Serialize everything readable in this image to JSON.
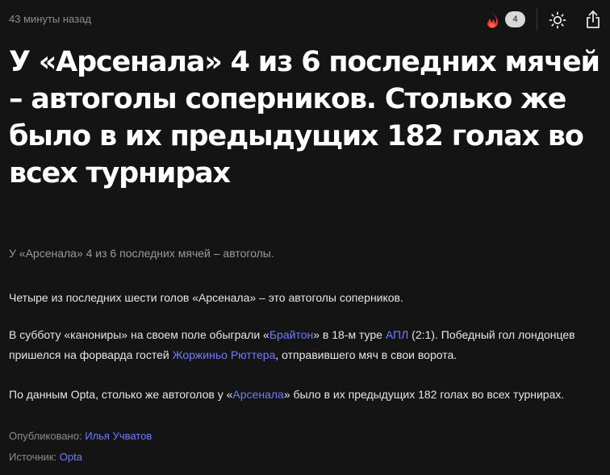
{
  "header": {
    "timestamp": "43 минуты назад",
    "reaction_count": "4",
    "icons": {
      "reaction": "fire-icon",
      "theme": "sun-icon",
      "share": "share-icon"
    }
  },
  "article": {
    "title": "У «Арсенала» 4 из 6 последних мячей – автоголы соперников. Столько же было в их предыдущих 182 голах во всех турнирах",
    "lead": "У «Арсенала» 4 из 6 последних мячей – автоголы.",
    "paragraph1": "Четыре из последних шести голов «Арсенала» – это автоголы соперников.",
    "paragraph2": {
      "t1": "В субботу «канониры» на своем поле обыграли «",
      "link_brighton": "Брайтон",
      "t2": "» в 18-м туре ",
      "link_apl": "АПЛ",
      "t3": " (2:1). Победный гол лондонцев пришелся на форварда гостей ",
      "link_player": "Жоржиньо Рюттера",
      "t4": ", отправившего мяч в свои ворота."
    },
    "paragraph3": {
      "t1": "По данным Opta, столько же автоголов у «",
      "link_arsenal": "Арсенала",
      "t2": "» было в их предыдущих 182 голах во всех турнирах."
    }
  },
  "meta": {
    "published_label": "Опубликовано:",
    "author": "Илья Учватов",
    "source_label": "Источник:",
    "source": "Opta"
  },
  "colors": {
    "background": "#141414",
    "link": "#6f7cff",
    "fire": "#e8362f"
  }
}
